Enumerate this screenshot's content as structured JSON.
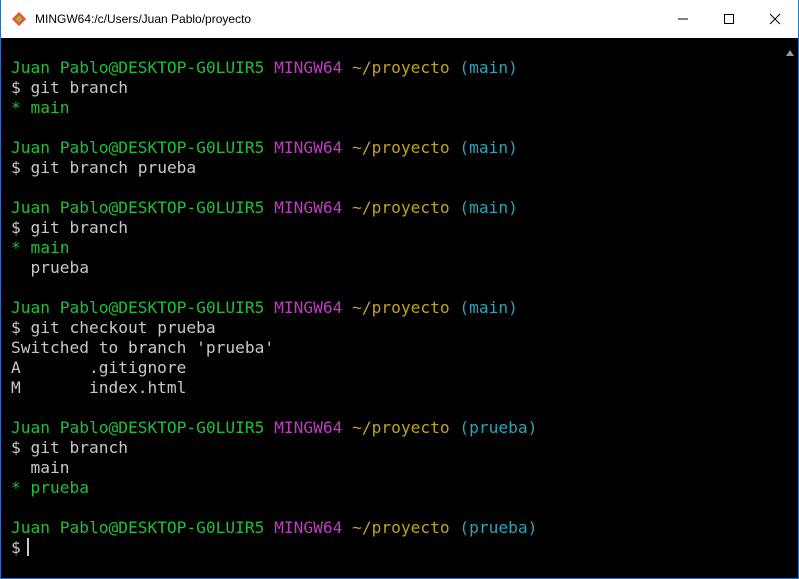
{
  "window": {
    "title": "MINGW64:/c/Users/Juan Pablo/proyecto",
    "minimize_label": "—",
    "maximize_label": "☐",
    "close_label": "✕"
  },
  "terminal": {
    "user_host": "Juan Pablo@DESKTOP-G0LUIR5",
    "env": "MINGW64",
    "path": "~/proyecto",
    "branch_main": "(main)",
    "branch_prueba": "(prueba)",
    "prompt_symbol": "$",
    "cmd1": "git branch",
    "out1_current": "* main",
    "cmd2": "git branch prueba",
    "cmd3": "git branch",
    "out3_current": "* main",
    "out3_other": "  prueba",
    "cmd4": "git checkout prueba",
    "out4_switched": "Switched to branch 'prueba'",
    "out4_file1": "A       .gitignore",
    "out4_file2": "M       index.html",
    "cmd5": "git branch",
    "out5_other": "  main",
    "out5_current": "* prueba"
  },
  "colors": {
    "user_host": "#1fbf3a",
    "env": "#c13cc1",
    "path": "#c1a31a",
    "branch": "#2aa5b5",
    "text": "#c8c8c8"
  },
  "icons": {
    "app": "git-diamond-icon",
    "minimize": "minimize-icon",
    "maximize": "maximize-icon",
    "close": "close-icon",
    "scroll_up": "scroll-up-arrow-icon"
  }
}
